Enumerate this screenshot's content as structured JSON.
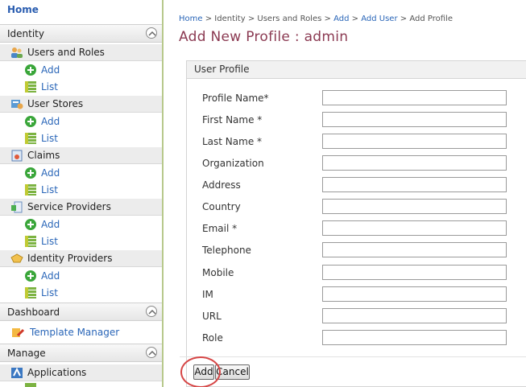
{
  "sidebar": {
    "home": "Home",
    "identity_header": "Identity",
    "groups": [
      {
        "label": "Users and Roles",
        "add": "Add",
        "list": "List"
      },
      {
        "label": "User Stores",
        "add": "Add",
        "list": "List"
      },
      {
        "label": "Claims",
        "add": "Add",
        "list": "List"
      },
      {
        "label": "Service Providers",
        "add": "Add",
        "list": "List"
      },
      {
        "label": "Identity Providers",
        "add": "Add",
        "list": "List"
      }
    ],
    "dashboard_header": "Dashboard",
    "template_manager": "Template Manager",
    "manage_header": "Manage",
    "applications": "Applications"
  },
  "breadcrumb": {
    "home": "Home",
    "identity": "Identity",
    "users_roles": "Users and Roles",
    "add": "Add",
    "add_user": "Add User",
    "current": "Add Profile",
    "sep": ">"
  },
  "page": {
    "title": "Add New Profile : admin"
  },
  "form": {
    "panel_title": "User Profile",
    "fields": [
      {
        "label": "Profile Name*",
        "value": ""
      },
      {
        "label": "First Name *",
        "value": ""
      },
      {
        "label": "Last Name *",
        "value": ""
      },
      {
        "label": "Organization",
        "value": ""
      },
      {
        "label": "Address",
        "value": ""
      },
      {
        "label": "Country",
        "value": ""
      },
      {
        "label": "Email *",
        "value": ""
      },
      {
        "label": "Telephone",
        "value": ""
      },
      {
        "label": "Mobile",
        "value": ""
      },
      {
        "label": "IM",
        "value": ""
      },
      {
        "label": "URL",
        "value": ""
      },
      {
        "label": "Role",
        "value": ""
      }
    ],
    "add_button": "Add",
    "cancel_button": "Cancel"
  },
  "colors": {
    "title": "#8b3a52",
    "link": "#2a66b8",
    "highlight": "#d64545",
    "sidebar_border": "#b8c98c"
  }
}
